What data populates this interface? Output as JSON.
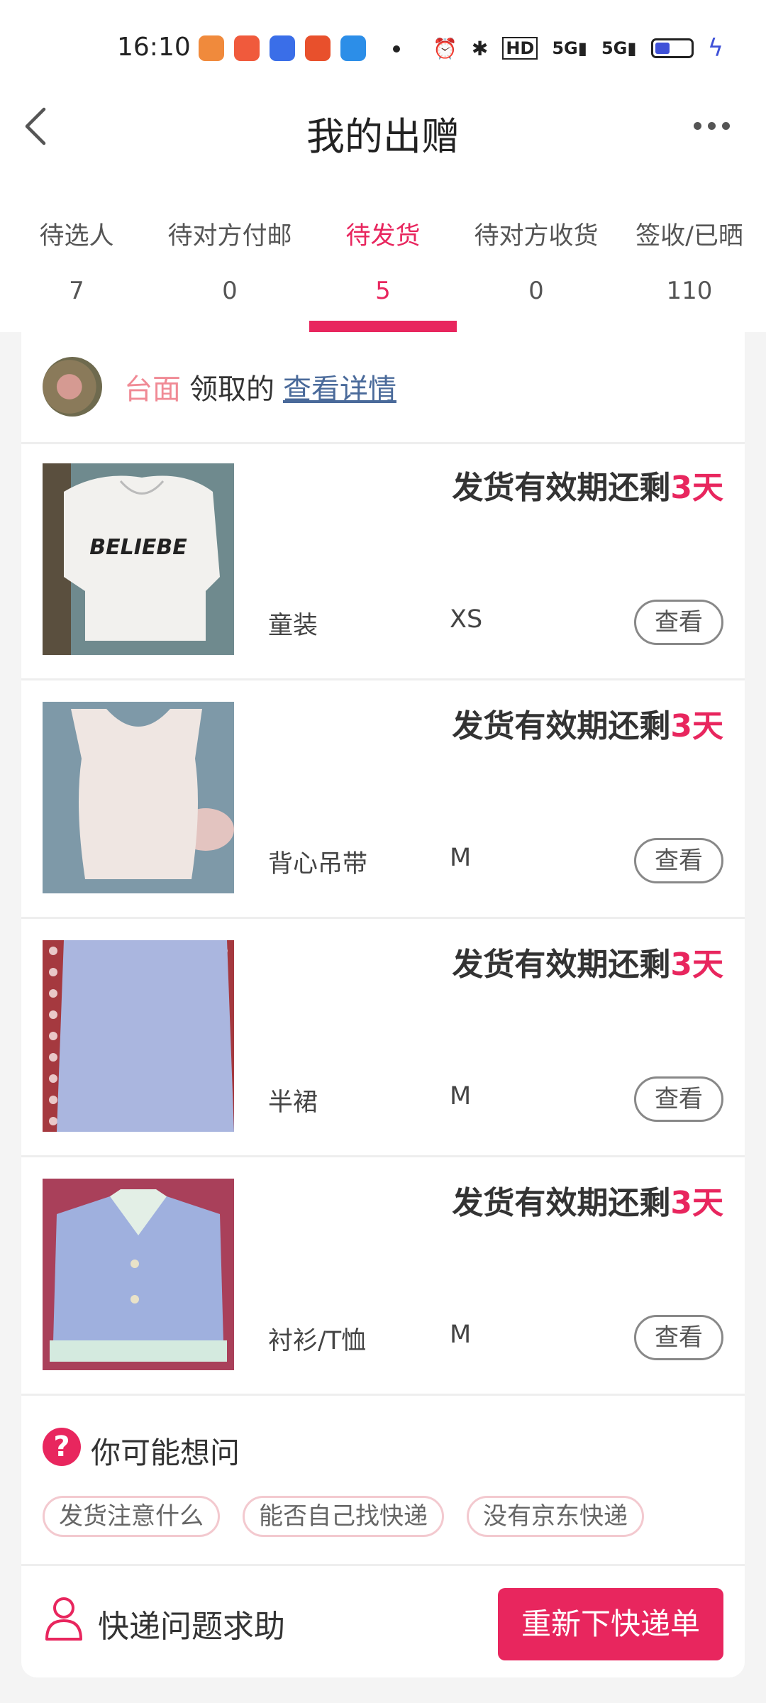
{
  "status_bar": {
    "time": "16:10",
    "network": "5G",
    "hd": "HD"
  },
  "header": {
    "title": "我的出赠"
  },
  "tabs": [
    {
      "label": "待选人",
      "count": "7"
    },
    {
      "label": "待对方付邮",
      "count": "0"
    },
    {
      "label": "待发货",
      "count": "5",
      "active": true
    },
    {
      "label": "待对方收货",
      "count": "0"
    },
    {
      "label": "签收/已晒",
      "count": "110"
    }
  ],
  "receiver": {
    "name": "台面",
    "claimed_text": "领取的",
    "view_details": "查看详情"
  },
  "items": [
    {
      "deadline_prefix": "发货有效期还剩",
      "deadline_days": "3天",
      "category": "童装",
      "size": "XS",
      "view_label": "查看",
      "thumb_text": "BELIEBE"
    },
    {
      "deadline_prefix": "发货有效期还剩",
      "deadline_days": "3天",
      "category": "背心吊带",
      "size": "M",
      "view_label": "查看"
    },
    {
      "deadline_prefix": "发货有效期还剩",
      "deadline_days": "3天",
      "category": "半裙",
      "size": "M",
      "view_label": "查看"
    },
    {
      "deadline_prefix": "发货有效期还剩",
      "deadline_days": "3天",
      "category": "衬衫/T恤",
      "size": "M",
      "view_label": "查看"
    }
  ],
  "faq": {
    "icon": "?",
    "title": "你可能想问",
    "chips": [
      "发货注意什么",
      "能否自己找快递",
      "没有京东快递"
    ]
  },
  "help": {
    "label": "快递问题求助",
    "button_label": "重新下快递单"
  },
  "colors": {
    "accent": "#e8265e",
    "name_pink": "#f08a95",
    "link": "#4a6a9a"
  }
}
